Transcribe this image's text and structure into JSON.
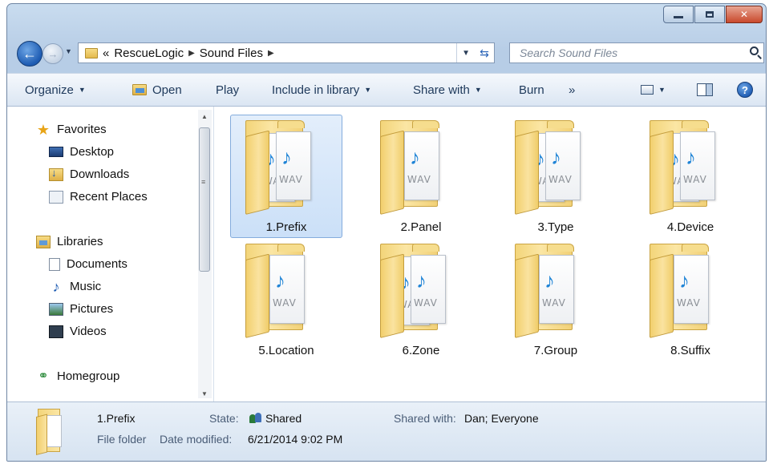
{
  "window": {
    "controls": {
      "minimize": "minimize-icon",
      "maximize": "maximize-icon",
      "close": "✕"
    }
  },
  "address": {
    "overflow": "«",
    "crumbs": [
      "RescueLogic",
      "Sound Files"
    ],
    "separator": "▶"
  },
  "search": {
    "placeholder": "Search Sound Files"
  },
  "toolbar": {
    "organize": "Organize",
    "open": "Open",
    "play": "Play",
    "include_in_library": "Include in library",
    "share_with": "Share with",
    "burn": "Burn",
    "more": "»",
    "help": "?"
  },
  "navpane": {
    "favorites": {
      "label": "Favorites",
      "items": [
        {
          "label": "Desktop",
          "icon": "desktop-icon"
        },
        {
          "label": "Downloads",
          "icon": "downloads-icon"
        },
        {
          "label": "Recent Places",
          "icon": "recent-places-icon"
        }
      ]
    },
    "libraries": {
      "label": "Libraries",
      "items": [
        {
          "label": "Documents",
          "icon": "documents-icon"
        },
        {
          "label": "Music",
          "icon": "music-icon"
        },
        {
          "label": "Pictures",
          "icon": "pictures-icon"
        },
        {
          "label": "Videos",
          "icon": "videos-icon"
        }
      ]
    },
    "homegroup": {
      "label": "Homegroup"
    }
  },
  "content": {
    "folders": [
      {
        "name": "1.Prefix",
        "selected": true,
        "papers": 2
      },
      {
        "name": "2.Panel",
        "selected": false,
        "papers": 1
      },
      {
        "name": "3.Type",
        "selected": false,
        "papers": 2
      },
      {
        "name": "4.Device",
        "selected": false,
        "papers": 2
      },
      {
        "name": "5.Location",
        "selected": false,
        "papers": 1
      },
      {
        "name": "6.Zone",
        "selected": false,
        "papers": 2
      },
      {
        "name": "7.Group",
        "selected": false,
        "papers": 1
      },
      {
        "name": "8.Suffix",
        "selected": false,
        "papers": 1
      }
    ],
    "wav_label": "WAV"
  },
  "details": {
    "name": "1.Prefix",
    "type": "File folder",
    "state_label": "State:",
    "state_value": "Shared",
    "shared_with_label": "Shared with:",
    "shared_with_value": "Dan; Everyone",
    "date_modified_label": "Date modified:",
    "date_modified_value": "6/21/2014 9:02 PM"
  }
}
